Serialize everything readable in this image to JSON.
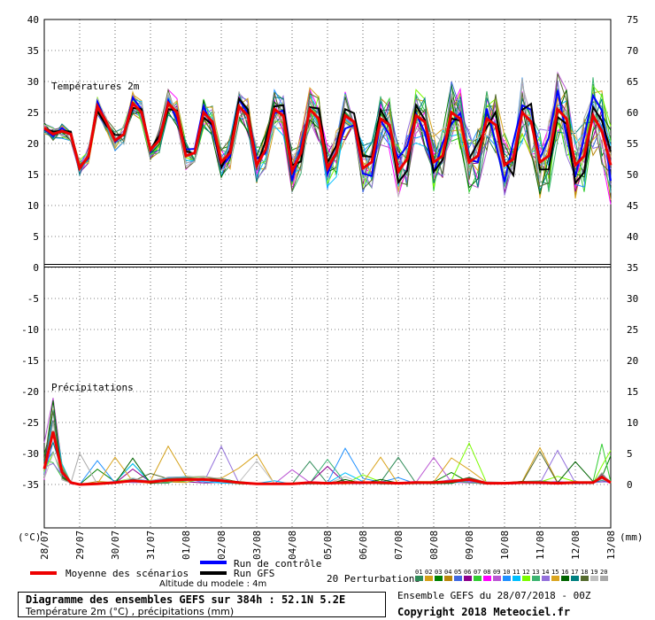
{
  "chart_data": {
    "type": "line",
    "labels": {
      "temp_section": "Températures 2m",
      "precip_section": "Précipitations",
      "left_unit": "(°C)",
      "right_unit": "(mm)"
    },
    "left_axis": {
      "ticks": [
        40,
        35,
        30,
        25,
        20,
        15,
        10,
        5,
        0,
        -5,
        -10,
        -15,
        -20,
        -25,
        -30,
        -35
      ],
      "range": [
        -35,
        40
      ]
    },
    "right_axis": {
      "ticks": [
        75,
        70,
        65,
        60,
        55,
        50,
        45,
        40,
        35,
        30,
        25,
        20,
        15,
        10,
        5,
        0
      ],
      "note": "right = left + 35"
    },
    "x_dates": [
      "28/07",
      "29/07",
      "30/07",
      "31/07",
      "01/08",
      "02/08",
      "03/08",
      "04/08",
      "05/08",
      "06/08",
      "07/08",
      "08/08",
      "09/08",
      "10/08",
      "11/08",
      "12/08",
      "13/08"
    ],
    "x_range_days": [
      0,
      16
    ],
    "mean_temperature": {
      "name": "Moyenne des scénarios",
      "color": "#ee0000",
      "x": [
        0,
        0.25,
        0.5,
        0.75,
        1,
        1.25,
        1.5,
        1.75,
        2,
        2.25,
        2.5,
        2.75,
        3,
        3.25,
        3.5,
        3.75,
        4,
        4.25,
        4.5,
        4.75,
        5,
        5.25,
        5.5,
        5.75,
        6,
        6.25,
        6.5,
        6.75,
        7,
        7.25,
        7.5,
        7.75,
        8,
        8.25,
        8.5,
        8.75,
        9,
        9.25,
        9.5,
        9.75,
        10,
        10.25,
        10.5,
        10.75,
        11,
        11.25,
        11.5,
        11.75,
        12,
        12.25,
        12.5,
        12.75,
        13,
        13.25,
        13.5,
        13.75,
        14,
        14.25,
        14.5,
        14.75,
        15,
        15.25,
        15.5,
        15.75,
        16
      ],
      "y": [
        22.5,
        21.5,
        22,
        21.5,
        16,
        18,
        26,
        23.5,
        20.5,
        21.5,
        26.5,
        25,
        19,
        20.5,
        26.5,
        25,
        18,
        18.5,
        25,
        23.5,
        17,
        18.5,
        26,
        24.5,
        16.5,
        19,
        25.5,
        24.5,
        15.5,
        18.5,
        25.5,
        24,
        16,
        18.5,
        24.5,
        23.5,
        16,
        17,
        24,
        23,
        15.5,
        17.5,
        24.5,
        23.5,
        17,
        18,
        25,
        24,
        17,
        18,
        24,
        23,
        16.5,
        17.5,
        25,
        23.5,
        17,
        18,
        25.5,
        24,
        16.5,
        18,
        24.5,
        22,
        16.5
      ]
    },
    "mean_precipitation": {
      "name": "Moyenne des scénarios",
      "x": [
        0,
        0.25,
        0.5,
        0.75,
        1,
        1.5,
        2,
        2.5,
        3,
        3.5,
        4,
        4.5,
        5,
        5.5,
        6,
        6.5,
        7,
        7.5,
        8,
        8.5,
        9,
        9.5,
        10,
        10.5,
        11,
        11.5,
        12,
        12.5,
        13,
        13.5,
        14,
        14.5,
        15,
        15.5,
        15.75,
        16
      ],
      "y": [
        2.5,
        8.5,
        2,
        0.3,
        0,
        0.1,
        0.3,
        0.6,
        0.4,
        0.7,
        0.8,
        0.8,
        0.6,
        0.3,
        0.1,
        0.1,
        0.1,
        0.3,
        0.2,
        0.3,
        0.3,
        0.3,
        0.2,
        0.3,
        0.3,
        0.5,
        0.8,
        0.2,
        0.2,
        0.3,
        0.3,
        0.2,
        0.3,
        0.3,
        1.2,
        0.3
      ]
    },
    "control_run": {
      "name": "Run de contrôle",
      "color": "#0000ff"
    },
    "gfs_run": {
      "name": "Run GFS",
      "color": "#000000"
    },
    "perturbations": {
      "label": "20 Perturbations",
      "numbers": [
        "01",
        "02",
        "03",
        "04",
        "05",
        "06",
        "07",
        "08",
        "09",
        "10",
        "11",
        "12",
        "13",
        "14",
        "15",
        "16",
        "17",
        "18",
        "19",
        "20"
      ],
      "colors": [
        "#2e8b57",
        "#d4a017",
        "#008000",
        "#b8860b",
        "#4169e1",
        "#8b008b",
        "#32cd32",
        "#ff00ff",
        "#ba55d3",
        "#1e90ff",
        "#00bfff",
        "#7cfc00",
        "#3cb371",
        "#9370db",
        "#daa520",
        "#006400",
        "#008080",
        "#556b2f",
        "#c0c0c0",
        "#a9a9a9"
      ]
    },
    "legend": {
      "position": "bottom"
    }
  },
  "footer": {
    "title": "Diagramme des ensembles GEFS sur 384h : 52.1N 5.2E",
    "subtitle": "Température 2m (°C) , précipitations (mm)",
    "altitude": "Altitude du modele : 4m",
    "ensemble_run": "Ensemble GEFS du 28/07/2018 - 00Z",
    "copyright": "Copyright 2018 Meteociel.fr"
  }
}
